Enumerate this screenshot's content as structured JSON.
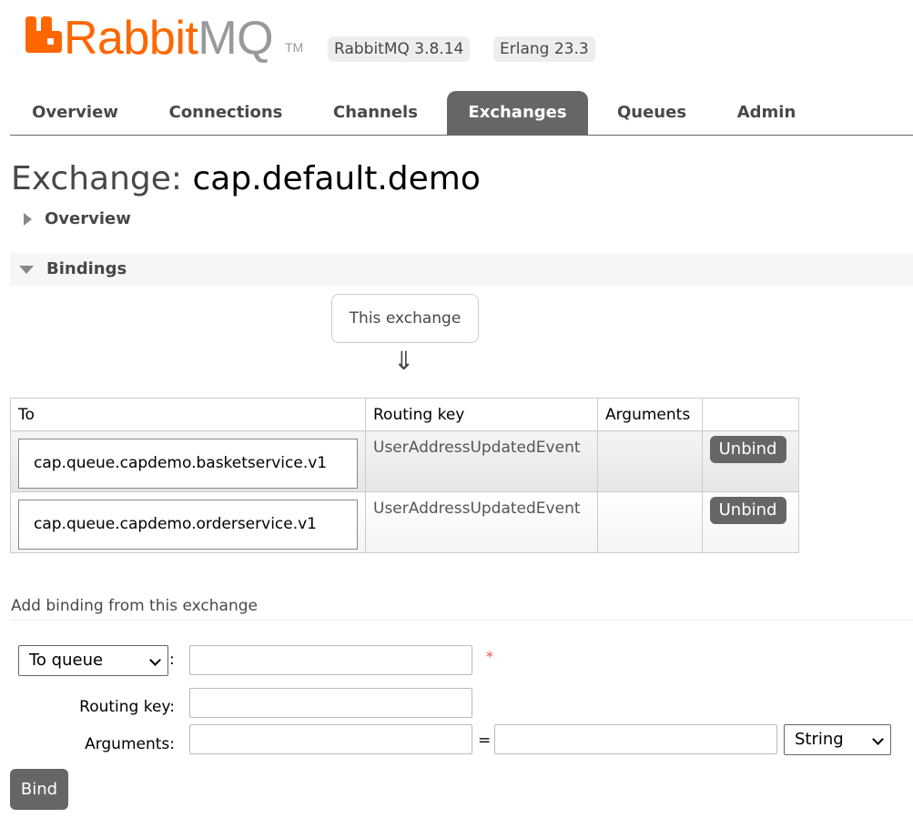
{
  "header": {
    "logo_text_a": "Rabbit",
    "logo_text_b": "MQ",
    "logo_tm": "TM",
    "version": "RabbitMQ 3.8.14",
    "erlang": "Erlang 23.3"
  },
  "nav": {
    "tabs": [
      "Overview",
      "Connections",
      "Channels",
      "Exchanges",
      "Queues",
      "Admin"
    ],
    "active": "Exchanges"
  },
  "page": {
    "title_prefix": "Exchange:",
    "exchange_name": "cap.default.demo"
  },
  "sections": {
    "overview": "Overview",
    "bindings": "Bindings"
  },
  "bindings": {
    "source_label": "This exchange",
    "arrow": "⇓",
    "columns": [
      "To",
      "Routing key",
      "Arguments",
      ""
    ],
    "rows": [
      {
        "to": "cap.queue.capdemo.basketservice.v1",
        "routing_key": "UserAddressUpdatedEvent",
        "arguments": "",
        "action": "Unbind"
      },
      {
        "to": "cap.queue.capdemo.orderservice.v1",
        "routing_key": "UserAddressUpdatedEvent",
        "arguments": "",
        "action": "Unbind"
      }
    ]
  },
  "add_binding": {
    "title": "Add binding from this exchange",
    "destination_type": "To queue",
    "destination_colon": ":",
    "destination_value": "",
    "required_mark": "*",
    "routing_key_label": "Routing key:",
    "routing_key_value": "",
    "arguments_label": "Arguments:",
    "arg_key": "",
    "equals": "=",
    "arg_value": "",
    "arg_type": "String",
    "bind_label": "Bind"
  },
  "colors": {
    "brand_orange": "#ff6600",
    "brand_grey": "#999999",
    "tab_active_bg": "#666666",
    "button_bg": "#666666"
  }
}
